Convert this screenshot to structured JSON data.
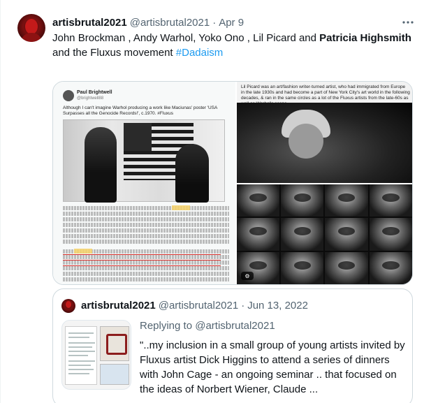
{
  "tweet": {
    "display_name": "artisbrutal2021",
    "handle": "@artisbrutal2021",
    "separator": "·",
    "date": "Apr 9",
    "more_icon": "more-icon",
    "text_part1": "John Brockman , Andy Warhol, Yoko Ono , Lil Picard and ",
    "text_bold": "Patricia Highsmith",
    "text_part2": " and the Fluxus movement ",
    "hashtag": "#Dadaism"
  },
  "media": {
    "left_screenshot": {
      "author": "Paul Brightwell",
      "handle": "@brightwell88",
      "quote": "Although I can't imagine Warhol producing a work like Maciunas' poster 'USA Surpasses all the Genocide Records!', c.1970. #Fluxus"
    },
    "right_top_text": "Lil Picard was an art/fashion writer-turned artist, who had immigrated from Europe in the late 1930s and had become a part of New York City's art world in the following decades, & ran in the same circles as a lot of the Fluxus artists from the late-60s as well as Warhol's scene."
  },
  "quoted_tweet": {
    "display_name": "artisbrutal2021",
    "handle": "@artisbrutal2021",
    "separator": "·",
    "date": "Jun 13, 2022",
    "replying_to": "Replying to @artisbrutal2021",
    "text": "\"..my inclusion in a small group of young artists invited by Fluxus artist Dick Higgins to attend a series of dinners with John Cage - an ongoing seminar .. that focused on the ideas of Norbert Wiener, Claude ..."
  },
  "colors": {
    "link": "#1d9bf0",
    "secondary_text": "#536471",
    "border": "#cfd9de"
  }
}
